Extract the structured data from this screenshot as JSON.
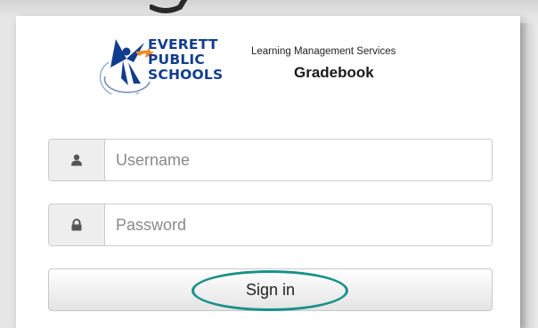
{
  "logo": {
    "lines": [
      "EVERETT",
      "PUBLIC",
      "SCHOOLS"
    ]
  },
  "header": {
    "subtitle": "Learning Management Services",
    "title": "Gradebook"
  },
  "form": {
    "username_placeholder": "Username",
    "password_placeholder": "Password",
    "signin_label": "Sign in"
  },
  "icons": {
    "username": "user-icon",
    "password": "lock-icon"
  },
  "colors": {
    "logo_blue": "#123d8f",
    "logo_orange": "#f08a24",
    "highlight_teal": "#17918a"
  }
}
